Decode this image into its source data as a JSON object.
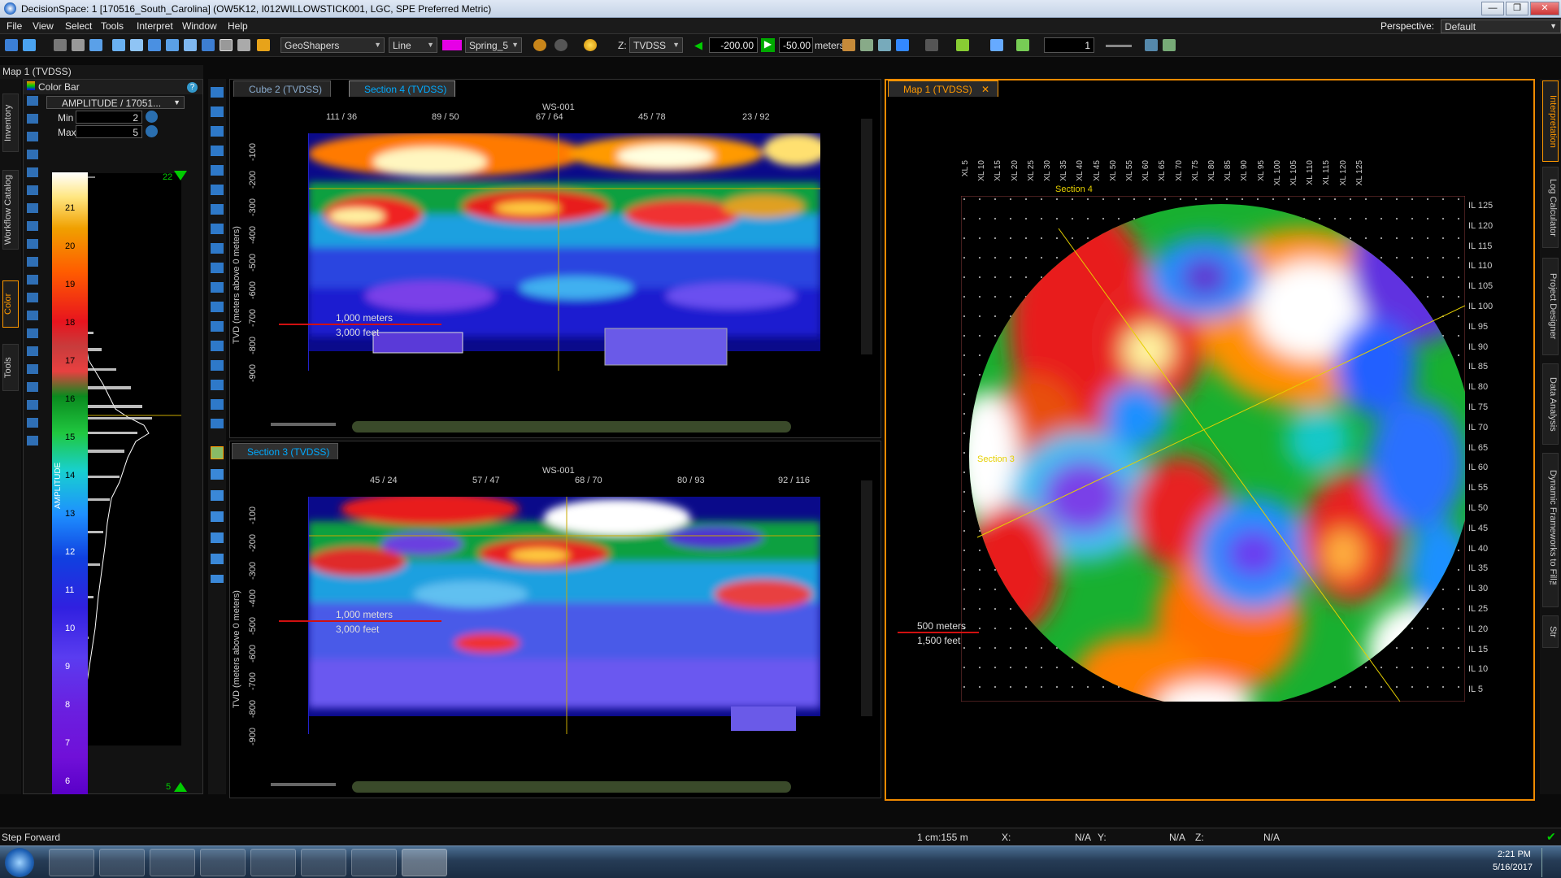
{
  "window": {
    "title": "DecisionSpace: 1 [170516_South_Carolina] (OW5K12, I012WILLOWSTICK001, LGC, SPE Preferred Metric)",
    "minimize": "—",
    "maximize": "❐",
    "close": "✕"
  },
  "menu": {
    "items": [
      "File",
      "View",
      "Select",
      "Tools",
      "Interpret",
      "Window",
      "Help"
    ],
    "perspective_label": "Perspective:",
    "perspective_value": "Default"
  },
  "toolbar": {
    "geoshapers": "GeoShapers",
    "line": "Line",
    "colormap": "Spring_5",
    "z_label": "Z:",
    "z_domain": "TVDSS",
    "z_min": "-200.00",
    "z_max": "-50.00",
    "units": "meters",
    "counter": "1"
  },
  "left_panel": {
    "map_header": "Map 1 (TVDSS)",
    "color_bar_title": "Color Bar",
    "attribute": "AMPLITUDE / 17051...",
    "min_label": "Min",
    "min_value": "2",
    "max_label": "Max",
    "max_value": "5",
    "top_marker": "22",
    "bottom_marker": "5",
    "axis_label": "AMPLITUDE",
    "ticks": [
      "21",
      "20",
      "19",
      "18",
      "17",
      "16",
      "15",
      "14",
      "13",
      "12",
      "11",
      "10",
      "9",
      "8",
      "7",
      "6"
    ]
  },
  "left_tabs": [
    "Inventory",
    "Workflow Catalog",
    "Color",
    "Tools"
  ],
  "right_tabs": [
    "Interpretation",
    "Log Calculator",
    "Project Designer",
    "Data Analysis",
    "Dynamic Frameworks to Fill™",
    "Str"
  ],
  "colors": {
    "accent": "#ff8c00",
    "tab_active": "#00aaff",
    "scale_red": "#d01010",
    "horizon_line": "#e6c200"
  },
  "section_top": {
    "tabs": [
      "Cube 2 (TVDSS)",
      "Section 4 (TVDSS)"
    ],
    "well": "WS-001",
    "top_ticks": [
      "111 / 36",
      "89 / 50",
      "67 / 64",
      "45 / 78",
      "23 / 92"
    ],
    "y_label": "TVD (meters above 0 meters)",
    "y_ticks": [
      "-100",
      "-200",
      "-300",
      "-400",
      "-500",
      "-600",
      "-700",
      "-800",
      "-900"
    ],
    "scale_m": "1,000 meters",
    "scale_ft": "3,000 feet"
  },
  "section_bottom": {
    "tab": "Section 3 (TVDSS)",
    "well": "WS-001",
    "top_ticks": [
      "45 / 24",
      "57 / 47",
      "68 / 70",
      "80 / 93",
      "92 / 116"
    ],
    "y_label": "TVD (meters above 0 meters)",
    "y_ticks": [
      "-100",
      "-200",
      "-300",
      "-400",
      "-500",
      "-600",
      "-700",
      "-800",
      "-900"
    ],
    "scale_m": "1,000 meters",
    "scale_ft": "3,000 feet"
  },
  "map_view": {
    "tab": "Map 1 (TVDSS)",
    "xl_ticks": [
      "XL 5",
      "XL 10",
      "XL 15",
      "XL 20",
      "XL 25",
      "XL 30",
      "XL 35",
      "XL 40",
      "XL 45",
      "XL 50",
      "XL 55",
      "XL 60",
      "XL 65",
      "XL 70",
      "XL 75",
      "XL 80",
      "XL 85",
      "XL 90",
      "XL 95",
      "XL 100",
      "XL 105",
      "XL 110",
      "XL 115",
      "XL 120",
      "XL 125"
    ],
    "il_ticks": [
      "IL 125",
      "IL 120",
      "IL 115",
      "IL 110",
      "IL 105",
      "IL 100",
      "IL 95",
      "IL 90",
      "IL 85",
      "IL 80",
      "IL 75",
      "IL 70",
      "IL 65",
      "IL 60",
      "IL 55",
      "IL 50",
      "IL 45",
      "IL 40",
      "IL 35",
      "IL 30",
      "IL 25",
      "IL 20",
      "IL 15",
      "IL 10",
      "IL 5"
    ],
    "section4_label": "Section 4",
    "section3_label": "Section 3",
    "scale_m": "500 meters",
    "scale_ft": "1,500 feet"
  },
  "status": {
    "message": "Step Forward",
    "scale": "1 cm:155 m",
    "x_label": "X:",
    "x_value": "N/A",
    "y_label": "Y:",
    "y_value": "N/A",
    "z_label": "Z:",
    "z_value": "N/A"
  },
  "taskbar": {
    "time": "2:21 PM",
    "date": "5/16/2017"
  }
}
